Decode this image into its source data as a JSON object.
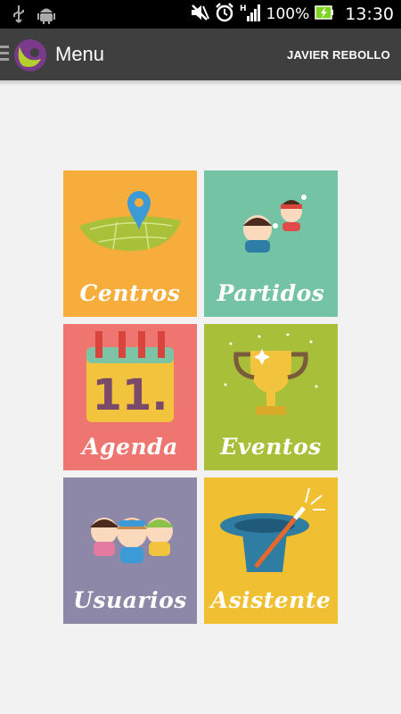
{
  "status_bar": {
    "battery": "100%",
    "time": "13:30",
    "icons": [
      "usb-icon",
      "android-debug-icon",
      "silent-icon",
      "alarm-icon",
      "signal-h-icon",
      "battery-icon"
    ]
  },
  "action_bar": {
    "title": "Menu",
    "user_name": "JAVIER REBOLLO",
    "logo_icon": "app-logo-icon",
    "drawer_icon": "drawer-indicator-icon"
  },
  "tiles": [
    {
      "label": "Centros",
      "color": "#f6ad3b",
      "icon": "map-pin-field-icon"
    },
    {
      "label": "Partidos",
      "color": "#74c3a5",
      "icon": "kids-playing-icon"
    },
    {
      "label": "Agenda",
      "color": "#ee7570",
      "icon": "calendar-icon",
      "calendar_day": "11."
    },
    {
      "label": "Eventos",
      "color": "#a8bf3a",
      "icon": "trophy-icon"
    },
    {
      "label": "Usuarios",
      "color": "#8d87a8",
      "icon": "children-group-icon"
    },
    {
      "label": "Asistente",
      "color": "#f0bf32",
      "icon": "magic-hat-icon"
    }
  ]
}
